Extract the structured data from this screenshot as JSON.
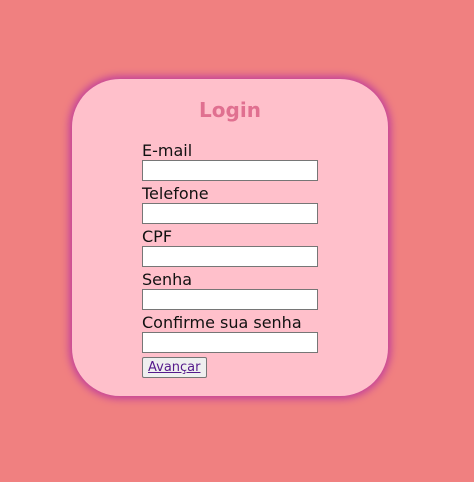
{
  "login": {
    "title": "Login",
    "fields": [
      {
        "label": "E-mail",
        "value": ""
      },
      {
        "label": "Telefone",
        "value": ""
      },
      {
        "label": "CPF",
        "value": ""
      },
      {
        "label": "Senha",
        "value": ""
      },
      {
        "label": "Confirme sua senha",
        "value": ""
      }
    ],
    "submit_label": "Avançar"
  },
  "colors": {
    "background": "#f08080",
    "card": "#ffc0cb",
    "card_glow": "#c2409a",
    "title": "#e07090",
    "link": "#551a8b"
  }
}
